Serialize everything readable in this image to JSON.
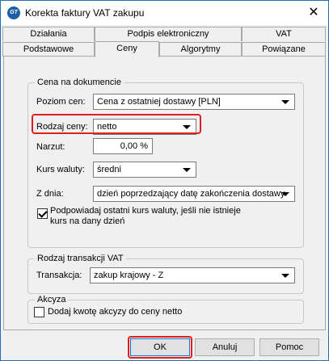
{
  "window": {
    "title": "Korekta faktury VAT zakupu",
    "icon_text": "GT"
  },
  "tabs": {
    "row1": [
      "Działania",
      "Podpis elektroniczny",
      "VAT"
    ],
    "row2": [
      "Podstawowe",
      "Ceny",
      "Algorytmy",
      "Powiązane"
    ],
    "active": "Ceny"
  },
  "price_group": {
    "legend": "Cena na dokumencie",
    "price_level_label": "Poziom cen:",
    "price_level_value": "Cena z ostatniej dostawy [PLN]",
    "price_type_label": "Rodzaj ceny:",
    "price_type_value": "netto",
    "markup_label": "Narzut:",
    "markup_value": "0,00 %",
    "exchange_rate_label": "Kurs waluty:",
    "exchange_rate_value": "średni",
    "from_day_label": "Z dnia:",
    "from_day_value": "dzień poprzedzający datę zakończenia dostawy",
    "suggest_rate_label": "Podpowiadaj ostatni kurs waluty, jeśli nie istnieje kurs na dany dzień",
    "suggest_rate_checked": true
  },
  "vat_group": {
    "legend": "Rodzaj transakcji VAT",
    "transaction_label": "Transakcja:",
    "transaction_value": "zakup krajowy - Z"
  },
  "excise_group": {
    "legend": "Akcyza",
    "add_excise_label": "Dodaj kwotę akcyzy do ceny netto",
    "add_excise_checked": false
  },
  "buttons": {
    "ok": "OK",
    "cancel": "Anuluj",
    "help": "Pomoc"
  }
}
